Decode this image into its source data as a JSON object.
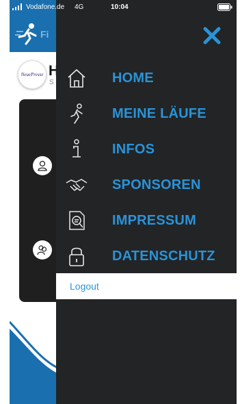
{
  "status_bar": {
    "carrier": "Vodafone.de",
    "network": "4G",
    "time": "10:04",
    "icons": [
      "signal-icon",
      "battery-icon"
    ]
  },
  "background_app": {
    "logo_text": "Fi",
    "avatar_text": "NeuePresse",
    "initial": "H",
    "initial_sub": "S"
  },
  "drawer": {
    "close_icon": "close-icon",
    "accent_color": "#2a93d8",
    "background_color": "#222426",
    "items": [
      {
        "label": "HOME",
        "icon": "home-icon"
      },
      {
        "label": "MEINE LÄUFE",
        "icon": "runner-icon"
      },
      {
        "label": "INFOS",
        "icon": "info-icon"
      },
      {
        "label": "SPONSOREN",
        "icon": "handshake-icon"
      },
      {
        "label": "IMPRESSUM",
        "icon": "document-search-icon"
      },
      {
        "label": "DATENSCHUTZ",
        "icon": "lock-icon"
      }
    ],
    "logout_label": "Logout"
  }
}
